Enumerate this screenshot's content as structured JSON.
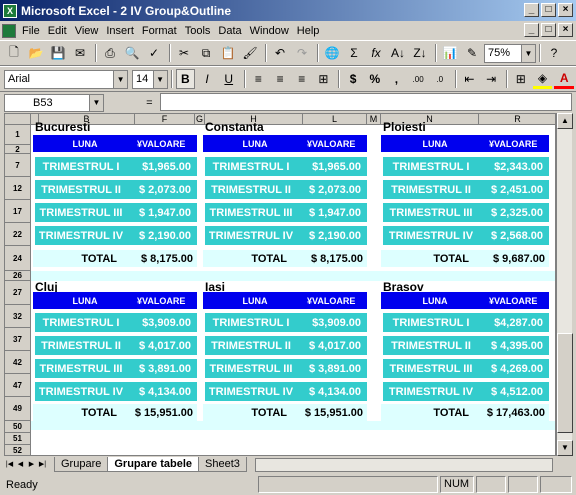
{
  "window": {
    "title": "Microsoft Excel - 2 IV Group&Outline"
  },
  "menu": [
    "File",
    "Edit",
    "View",
    "Insert",
    "Format",
    "Tools",
    "Data",
    "Window",
    "Help"
  ],
  "toolbar": {
    "zoom": "75%",
    "font": "Arial",
    "size": "14",
    "bold": "B",
    "italic": "I",
    "underline": "U",
    "currency": "$",
    "percent": "%",
    "comma": ",",
    "sum": "Σ",
    "fx": "fx",
    "help": "?"
  },
  "formula": {
    "cell_ref": "B53",
    "fx_label": "="
  },
  "columns": [
    "B",
    "F",
    "G",
    "H",
    "L",
    "M",
    "N",
    "R"
  ],
  "rows": [
    "1",
    "2",
    "7",
    "12",
    "17",
    "22",
    "24",
    "26",
    "27",
    "32",
    "37",
    "42",
    "47",
    "49",
    "50",
    "51",
    "52"
  ],
  "header": {
    "luna": "LUNA",
    "valoare": "¥VALOARE"
  },
  "quarters": [
    "TRIMESTRUL  I",
    "TRIMESTRUL  II",
    "TRIMESTRUL  III",
    "TRIMESTRUL  IV"
  ],
  "total_label": "TOTAL",
  "blocks": [
    {
      "city": "Bucuresti",
      "values": [
        "$1,965.00",
        "$  2,073.00",
        "$  1,947.00",
        "$  2,190.00"
      ],
      "total": "$  8,175.00"
    },
    {
      "city": "Constanta",
      "values": [
        "$1,965.00",
        "$  2,073.00",
        "$  1,947.00",
        "$  2,190.00"
      ],
      "total": "$  8,175.00"
    },
    {
      "city": "Ploiesti",
      "values": [
        "$2,343.00",
        "$  2,451.00",
        "$  2,325.00",
        "$  2,568.00"
      ],
      "total": "$  9,687.00"
    },
    {
      "city": "Cluj",
      "values": [
        "$3,909.00",
        "$  4,017.00",
        "$  3,891.00",
        "$  4,134.00"
      ],
      "total": "$ 15,951.00"
    },
    {
      "city": "Iasi",
      "values": [
        "$3,909.00",
        "$  4,017.00",
        "$  3,891.00",
        "$  4,134.00"
      ],
      "total": "$ 15,951.00"
    },
    {
      "city": "Brasov",
      "values": [
        "$4,287.00",
        "$  4,395.00",
        "$  4,269.00",
        "$  4,512.00"
      ],
      "total": "$ 17,463.00"
    }
  ],
  "sheets": [
    "Grupare",
    "Grupare tabele",
    "Sheet3"
  ],
  "status": {
    "ready": "Ready",
    "num": "NUM"
  }
}
